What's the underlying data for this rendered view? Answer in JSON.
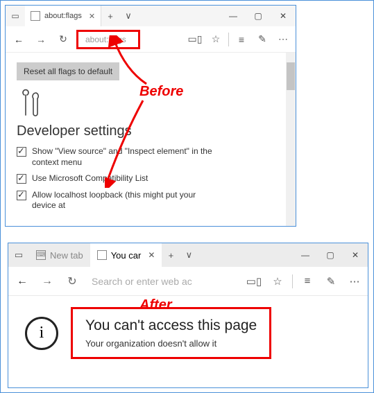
{
  "callouts": {
    "before": "Before",
    "after": "After"
  },
  "win1": {
    "tab_label": "about:flags",
    "address": "about:flags",
    "reset_button": "Reset all flags to default",
    "section_heading": "Developer settings",
    "options": [
      "Show \"View source\" and \"Inspect element\" in the context menu",
      "Use Microsoft Compatibility List",
      "Allow localhost loopback (this might put your device at"
    ],
    "icons": {
      "back": "←",
      "forward": "→",
      "refresh": "↻",
      "reading": "▭▯",
      "star": "☆",
      "hub": "≡",
      "pen": "✎",
      "more": "⋯",
      "plus": "+",
      "chevdown": "∨",
      "min": "—",
      "max": "▢",
      "close": "✕",
      "tabstrip_left": "▭"
    }
  },
  "win2": {
    "tab_inactive": "New tab",
    "tab_active": "You car",
    "address_placeholder": "Search or enter web ac",
    "info_glyph": "i",
    "msg_title": "You can't access this page",
    "msg_sub": "Your organization doesn't allow it",
    "icons": {
      "back": "←",
      "forward": "→",
      "refresh": "↻",
      "reading": "▭▯",
      "star": "☆",
      "hub": "≡",
      "pen": "✎",
      "more": "⋯",
      "plus": "+",
      "chevdown": "∨",
      "min": "—",
      "max": "▢",
      "close": "✕",
      "tabstrip_left": "▭",
      "kbd": "⌨"
    }
  }
}
